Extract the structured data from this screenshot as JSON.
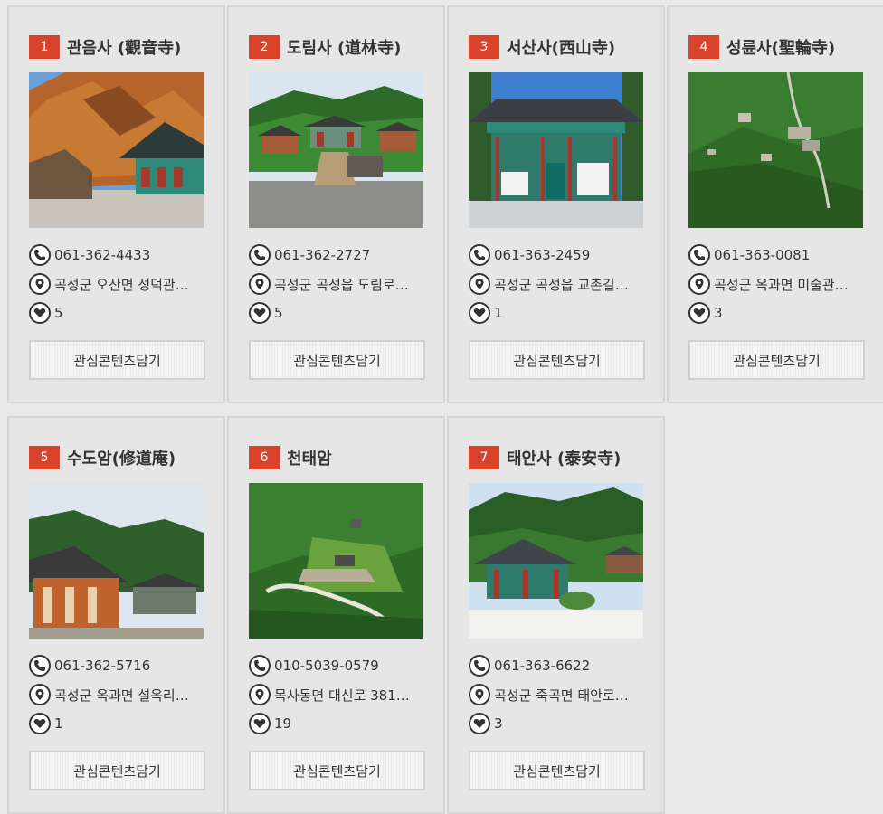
{
  "fav_button_label": "관심콘텐츠담기",
  "accent_color": "#d9432b",
  "cards": [
    {
      "num": "1",
      "title": "관음사 (觀音寺)",
      "phone": "061-362-4433",
      "address": "곡성군 오산면 성덕관…",
      "likes": "5",
      "image": "temple-autumn-photo"
    },
    {
      "num": "2",
      "title": "도림사 (道林寺)",
      "phone": "061-362-2727",
      "address": "곡성군 곡성읍 도림로…",
      "likes": "5",
      "image": "temple-courtyard-photo"
    },
    {
      "num": "3",
      "title": "서산사(西山寺)",
      "phone": "061-363-2459",
      "address": "곡성군 곡성읍 교촌길…",
      "likes": "1",
      "image": "temple-hall-photo"
    },
    {
      "num": "4",
      "title": "성륜사(聖輪寺)",
      "phone": "061-363-0081",
      "address": "곡성군 옥과면 미술관…",
      "likes": "3",
      "image": "temple-aerial-photo"
    },
    {
      "num": "5",
      "title": "수도암(修道庵)",
      "phone": "061-362-5716",
      "address": "곡성군 옥과면 설옥리…",
      "likes": "1",
      "image": "hermitage-photo"
    },
    {
      "num": "6",
      "title": "천태암",
      "phone": "010-5039-0579",
      "address": "목사동면 대신로 381…",
      "likes": "19",
      "image": "mountain-hermitage-photo"
    },
    {
      "num": "7",
      "title": "태안사 (泰安寺)",
      "phone": "061-363-6622",
      "address": "곡성군 죽곡면 태안로…",
      "likes": "3",
      "image": "temple-forest-photo"
    }
  ]
}
